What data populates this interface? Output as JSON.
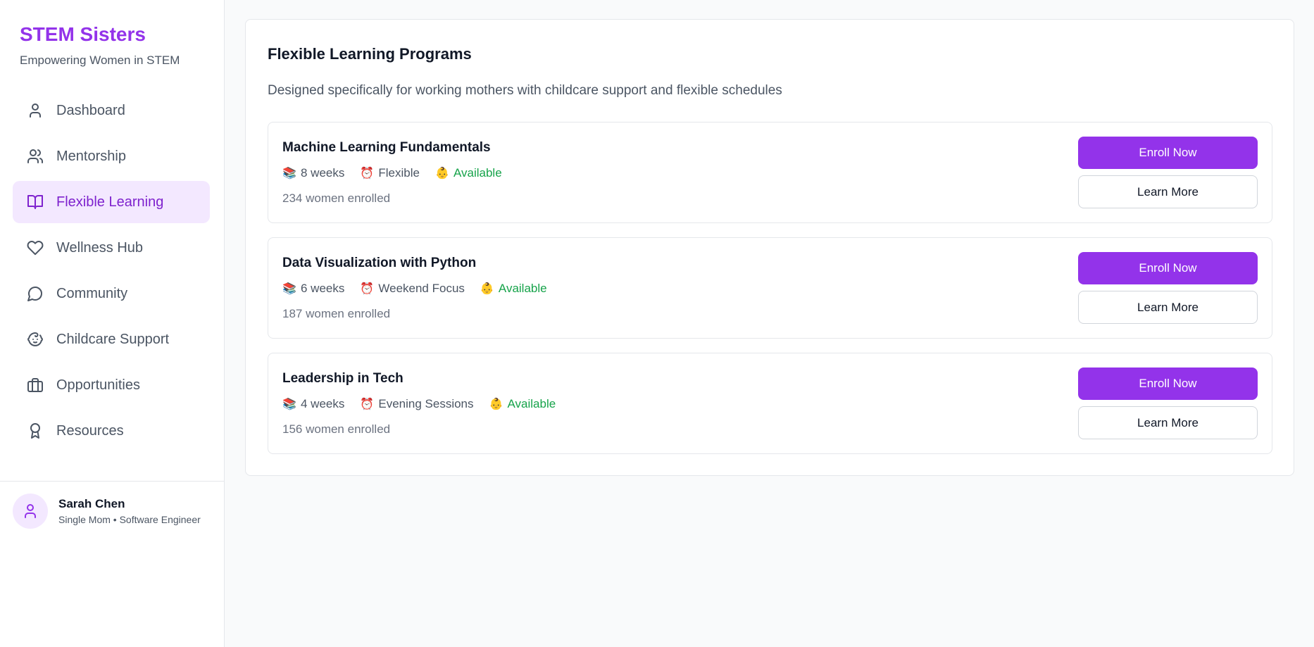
{
  "sidebar": {
    "brand_title": "STEM Sisters",
    "brand_subtitle": "Empowering Women in STEM",
    "nav": [
      {
        "label": "Dashboard",
        "icon": "user-icon",
        "active": false
      },
      {
        "label": "Mentorship",
        "icon": "users-icon",
        "active": false
      },
      {
        "label": "Flexible Learning",
        "icon": "book-open-icon",
        "active": true
      },
      {
        "label": "Wellness Hub",
        "icon": "heart-icon",
        "active": false
      },
      {
        "label": "Community",
        "icon": "message-circle-icon",
        "active": false
      },
      {
        "label": "Childcare Support",
        "icon": "baby-icon",
        "active": false
      },
      {
        "label": "Opportunities",
        "icon": "briefcase-icon",
        "active": false
      },
      {
        "label": "Resources",
        "icon": "award-icon",
        "active": false
      }
    ],
    "user": {
      "name": "Sarah Chen",
      "role": "Single Mom • Software Engineer"
    }
  },
  "main": {
    "title": "Flexible Learning Programs",
    "subtitle": "Designed specifically for working mothers with childcare support and flexible schedules",
    "programs": [
      {
        "title": "Machine Learning Fundamentals",
        "duration": "8 weeks",
        "schedule": "Flexible",
        "childcare": "Available",
        "enrolled": "234 women enrolled",
        "enroll_label": "Enroll Now",
        "learn_label": "Learn More"
      },
      {
        "title": "Data Visualization with Python",
        "duration": "6 weeks",
        "schedule": "Weekend Focus",
        "childcare": "Available",
        "enrolled": "187 women enrolled",
        "enroll_label": "Enroll Now",
        "learn_label": "Learn More"
      },
      {
        "title": "Leadership in Tech",
        "duration": "4 weeks",
        "schedule": "Evening Sessions",
        "childcare": "Available",
        "enrolled": "156 women enrolled",
        "enroll_label": "Enroll Now",
        "learn_label": "Learn More"
      }
    ],
    "meta_icons": {
      "duration": "📚",
      "schedule": "⏰",
      "childcare": "👶"
    }
  },
  "colors": {
    "accent": "#9333ea",
    "active_bg": "#f3e8ff",
    "available": "#16a34a"
  }
}
